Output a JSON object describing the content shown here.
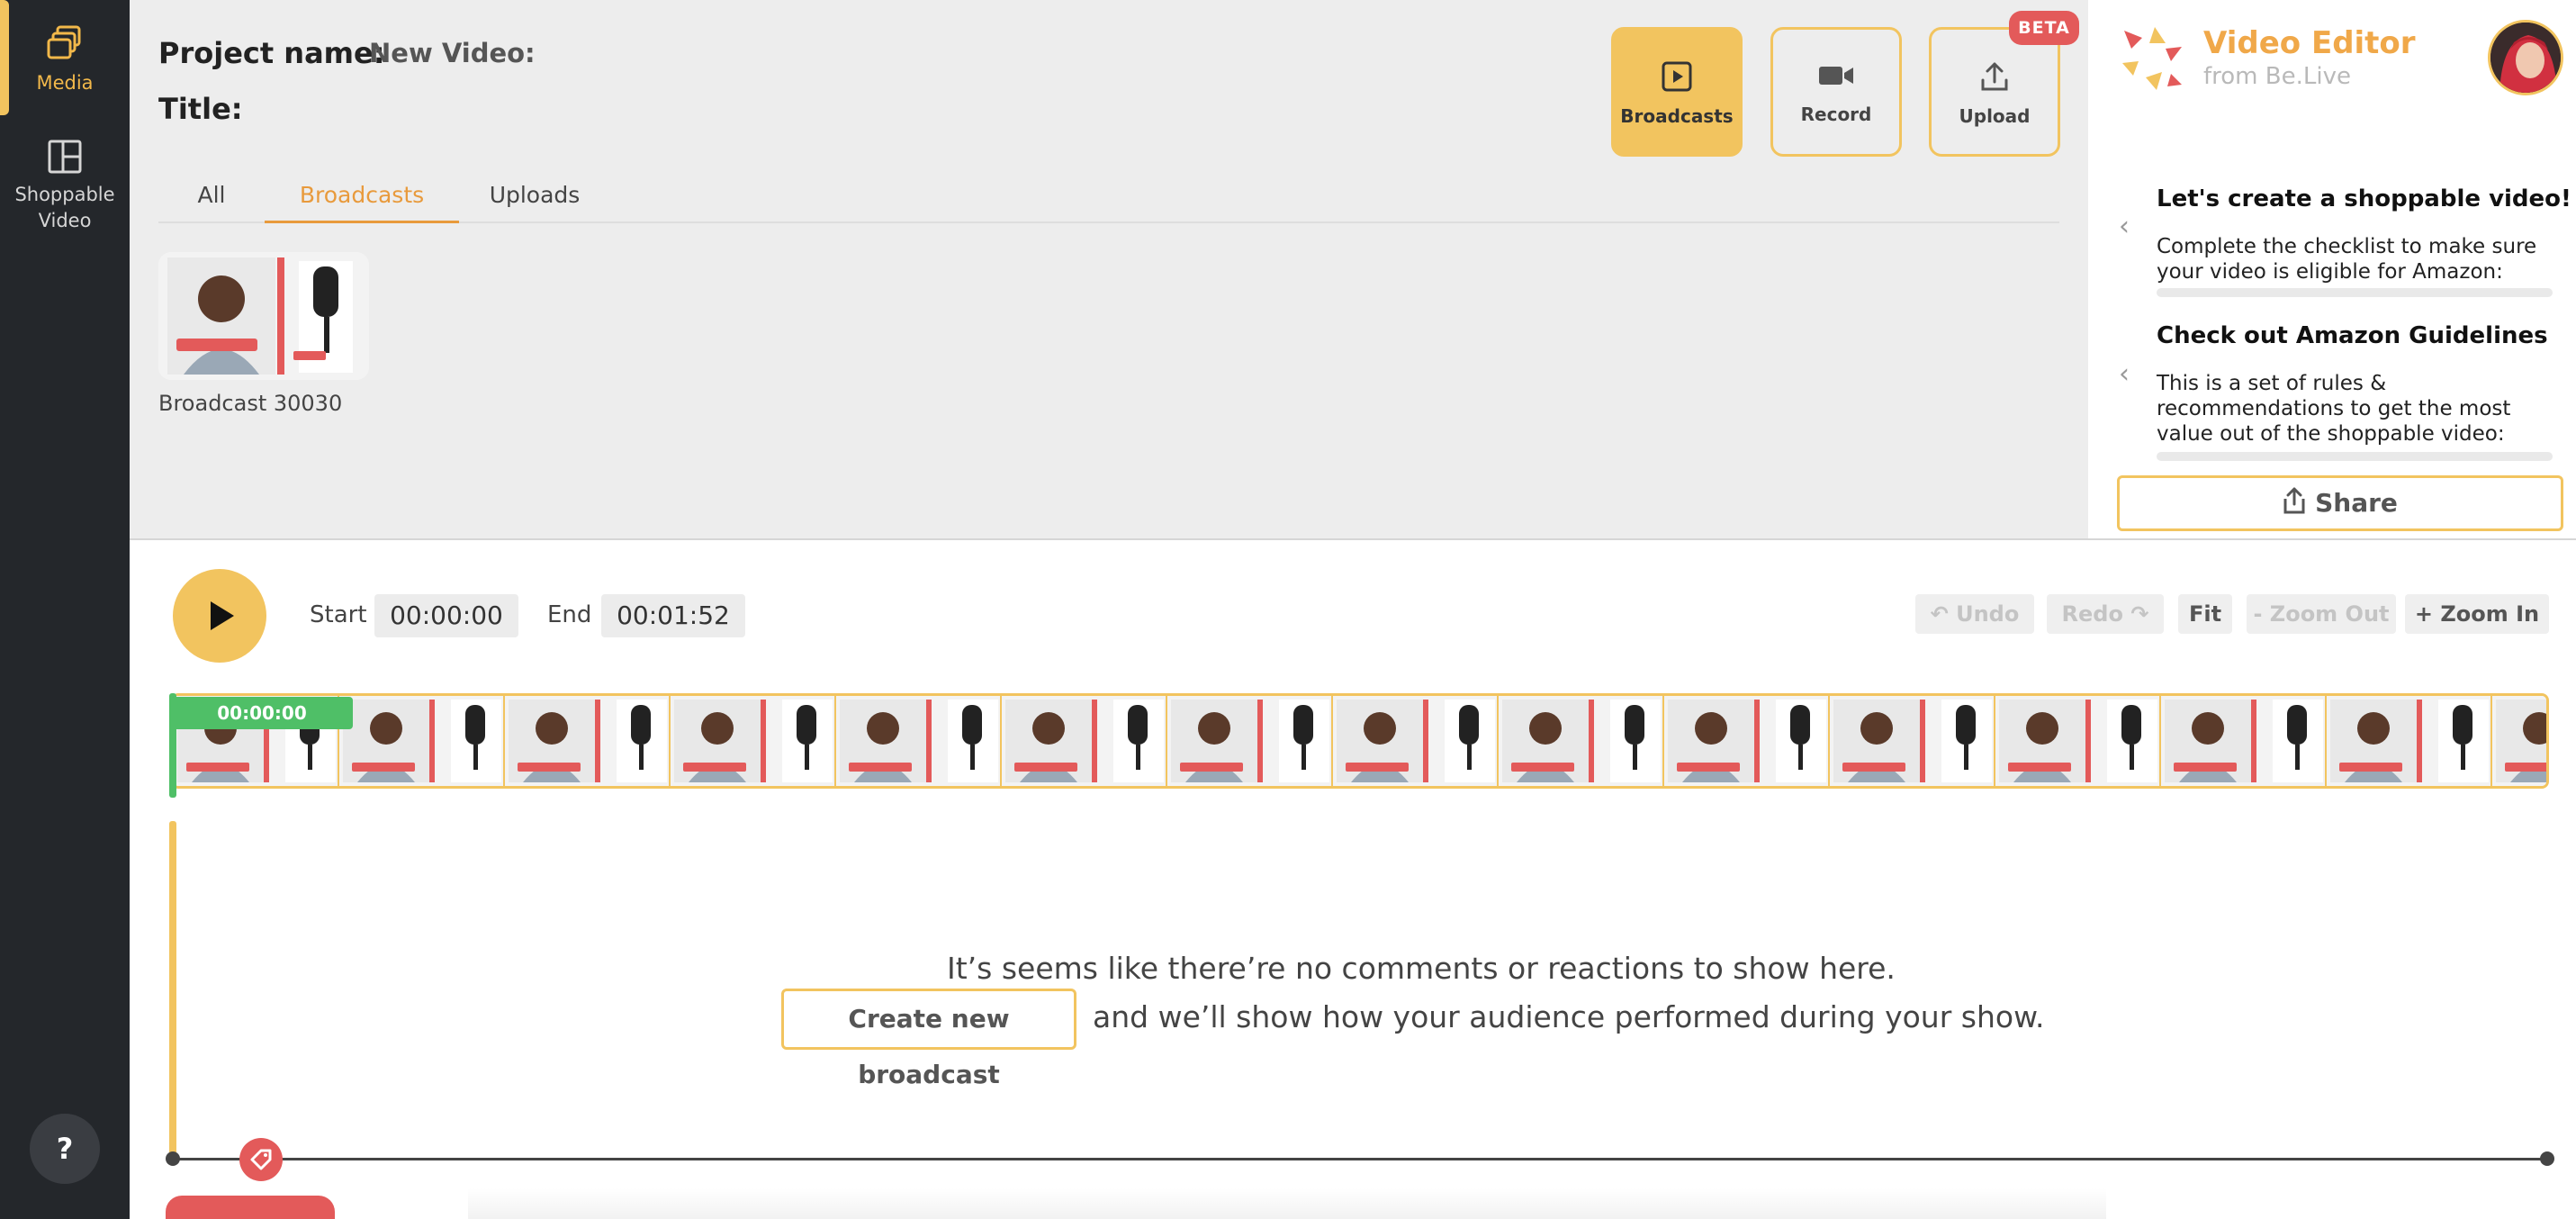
{
  "sidebar": {
    "items": [
      {
        "label": "Media",
        "icon": "media-stack-icon"
      },
      {
        "label": "Shoppable Video",
        "icon": "layout-icon"
      }
    ],
    "help_label": "?"
  },
  "project": {
    "name_label": "Project name:",
    "name_value": "New Video:",
    "title_label": "Title:"
  },
  "tabs": [
    "All",
    "Broadcasts",
    "Uploads"
  ],
  "active_tab": "Broadcasts",
  "media": [
    {
      "caption": "Broadcast 30030"
    }
  ],
  "actions": {
    "broadcasts": "Broadcasts",
    "record": "Record",
    "upload": "Upload",
    "beta_badge": "BETA"
  },
  "brand": {
    "title": "Video Editor",
    "subtitle": "from Be.Live"
  },
  "checklist": [
    {
      "title": "Let's create a shoppable video!",
      "body": "Complete the checklist to make sure your video is eligible for Amazon:"
    },
    {
      "title": "Check out Amazon Guidelines",
      "body": "This is a set of rules & recommendations to get the most value out of the shoppable video:"
    }
  ],
  "share_label": "Share",
  "timeline": {
    "start_label": "Start",
    "start_value": "00:00:00",
    "end_label": "End",
    "end_value": "00:01:52",
    "current_time": "00:00:00",
    "controls": {
      "undo": "Undo",
      "redo": "Redo",
      "fit": "Fit",
      "zoom_out": "- Zoom Out",
      "zoom_in": "+ Zoom In"
    }
  },
  "empty_state": {
    "line1": "It’s seems like there’re no comments or reactions to show here.",
    "create_button": "Create new broadcast",
    "line2": "and we’ll show how your audience performed during your show."
  },
  "colors": {
    "accent": "#f2c45f",
    "active_tab": "#e89a3c",
    "brand": "#f0a849",
    "beta": "#e35a5a",
    "timeline_marker": "#4fbf67",
    "sidebar_bg": "#24272b"
  }
}
